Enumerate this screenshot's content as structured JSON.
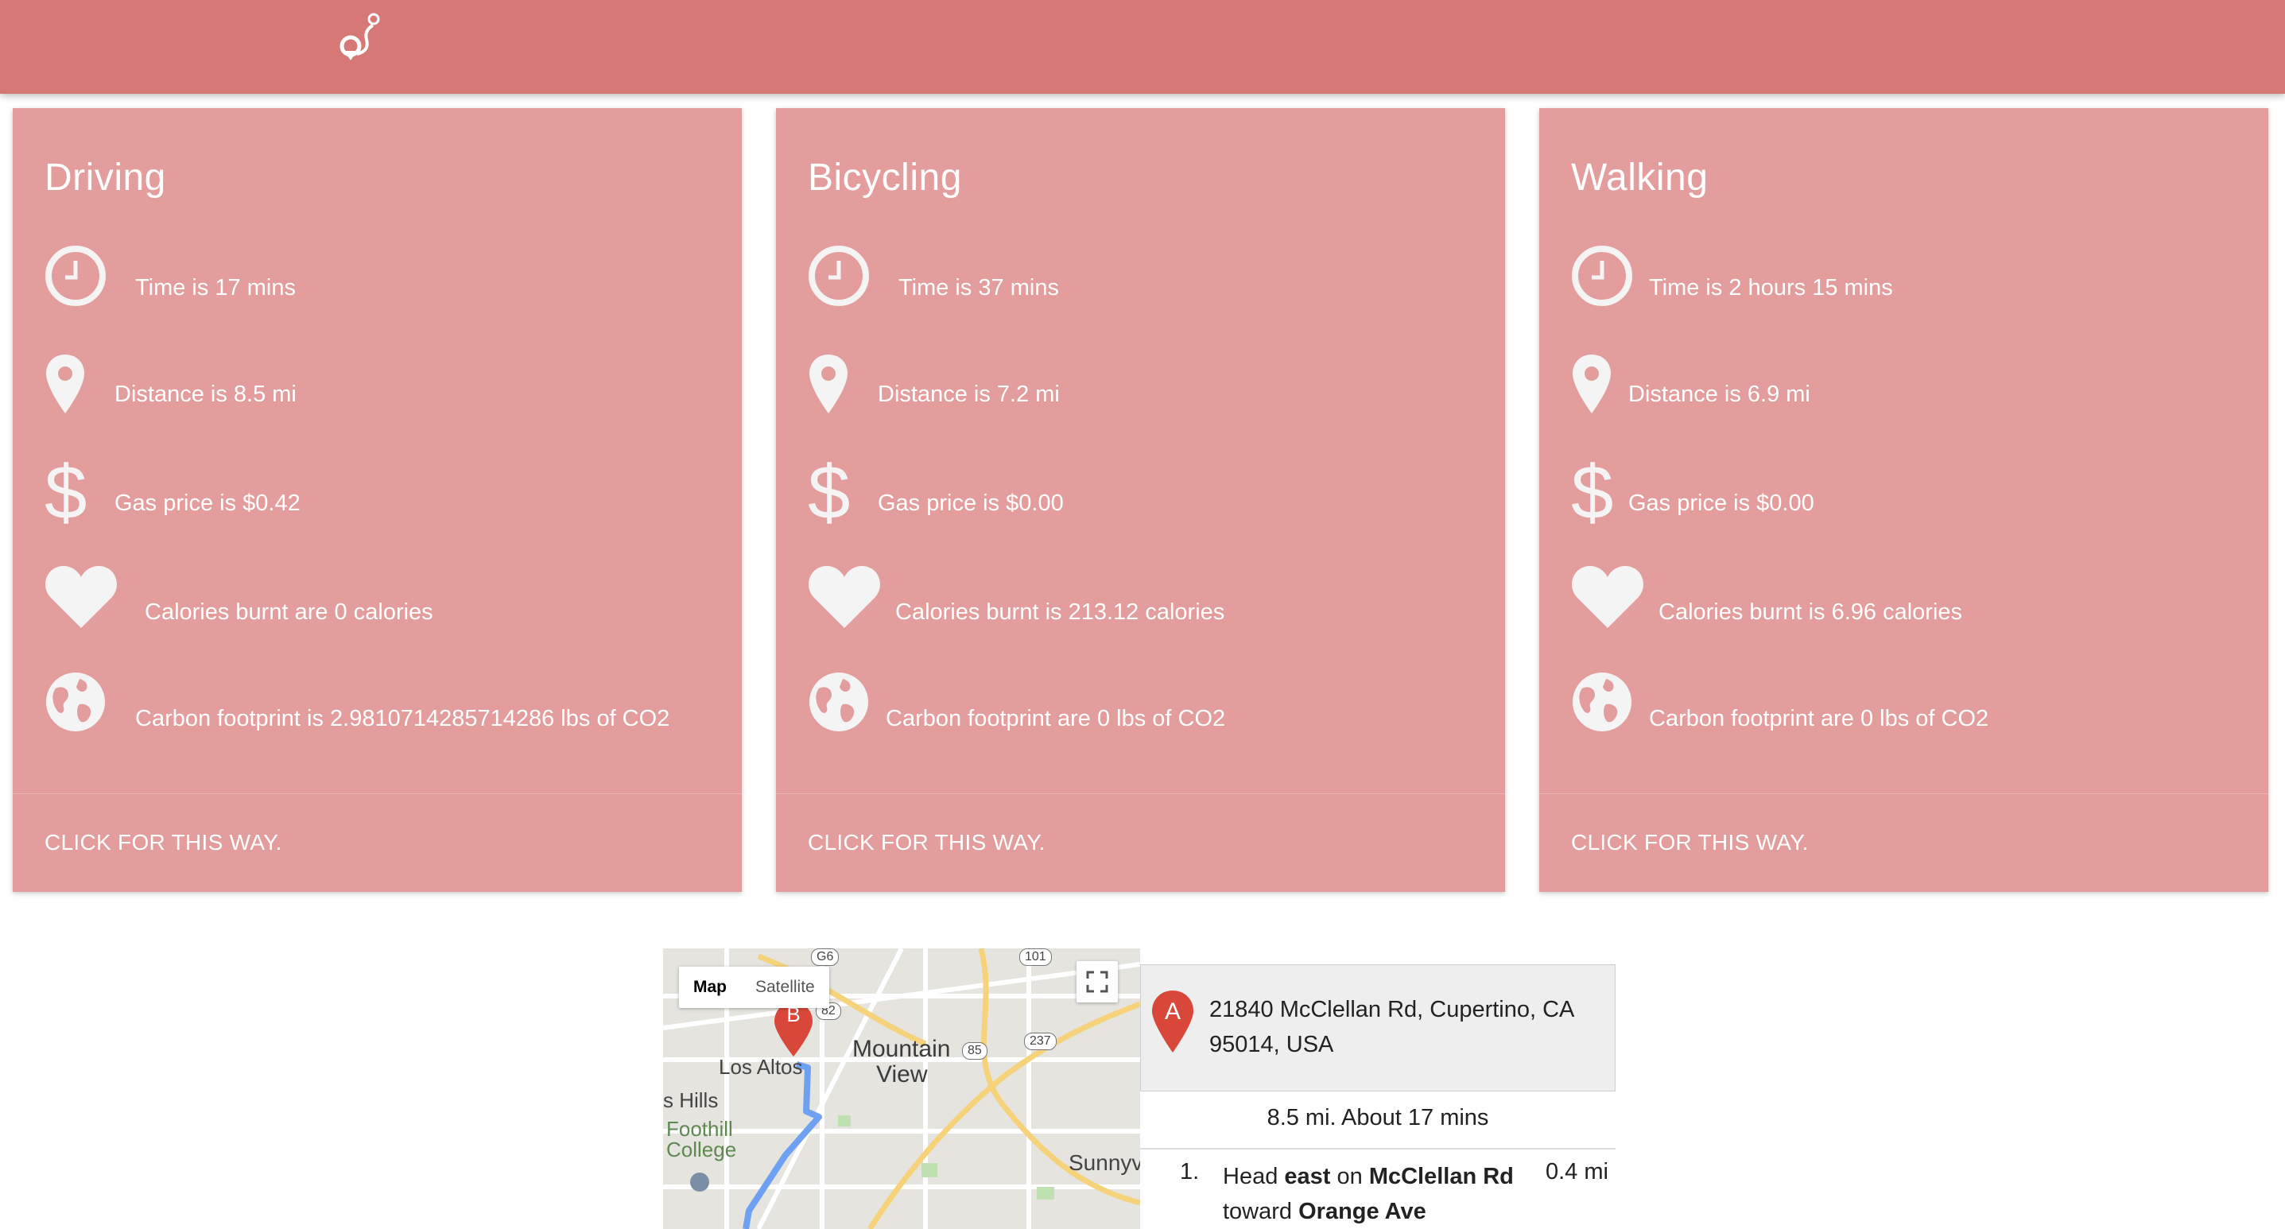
{
  "header": {
    "logo_icon": "route-pin-icon",
    "color": "#d67876"
  },
  "card_color": "#e39d9c",
  "cards": [
    {
      "title": "Driving",
      "time": "Time is 17 mins",
      "distance": "Distance is 8.5 mi",
      "gas": "Gas price is $0.42",
      "calories": "Calories burnt are 0 calories",
      "carbon": "Carbon footprint is 2.9810714285714286 lbs of CO2",
      "action": "CLICK FOR THIS WAY."
    },
    {
      "title": "Bicycling",
      "time": "Time is 37 mins",
      "distance": "Distance is 7.2 mi",
      "gas": "Gas price is $0.00",
      "calories": "Calories burnt is 213.12 calories",
      "carbon": "Carbon footprint are 0 lbs of CO2",
      "action": "CLICK FOR THIS WAY."
    },
    {
      "title": "Walking",
      "time": "Time is 2 hours 15 mins",
      "distance": "Distance is 6.9 mi",
      "gas": "Gas price is $0.00",
      "calories": "Calories burnt is 6.96 calories",
      "carbon": "Carbon footprint are 0 lbs of CO2",
      "action": "CLICK FOR THIS WAY."
    }
  ],
  "map": {
    "type_map": "Map",
    "type_satellite": "Satellite",
    "labels": {
      "mountain_view_1": "Mountain",
      "mountain_view_2": "View",
      "los_altos": "Los Altos",
      "hills": "s Hills",
      "foothill_1": "Foothill",
      "foothill_2": "College",
      "sunnyvale": "Sunnyv"
    },
    "shields": {
      "g6": "G6",
      "r101": "101",
      "r82": "82",
      "r85": "85",
      "r237": "237"
    },
    "marker_b": "B"
  },
  "directions": {
    "start_marker": "A",
    "start_address": "21840 McClellan Rd, Cupertino, CA 95014, USA",
    "summary": "8.5 mi. About 17 mins",
    "steps": [
      {
        "num": "1.",
        "pre": "Head ",
        "dir": "east",
        "mid": " on ",
        "road": "McClellan Rd",
        "toward_word": " toward ",
        "toward": "Orange Ave",
        "distance": "0.4 mi"
      }
    ]
  }
}
